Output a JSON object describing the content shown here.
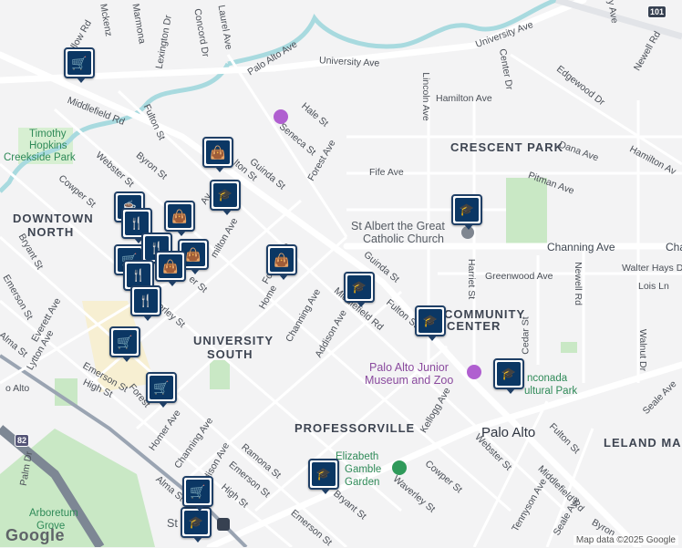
{
  "neighborhoods": [
    "DOWNTOWN",
    "NORTH",
    "UNIVERSITY",
    "SOUTH",
    "CRESCENT PARK",
    "PROFESSORVILLE",
    "COMMUNITY",
    "CENTER",
    "LELAND MAN"
  ],
  "city": "Palo Alto",
  "pois": {
    "park1": "Timothy",
    "park2": "Hopkins",
    "park3": "Creekside Park",
    "church1": "St Albert the Great",
    "church2": "Catholic Church",
    "museum1": "Palo Alto Junior",
    "museum2": "Museum and Zoo",
    "garden1": "Elizabeth",
    "garden2": "Gamble",
    "garden3": "Garden",
    "arboretum1": "Arboretum",
    "arboretum2": "Grove",
    "cultural1": "nconada",
    "cultural2": "ultural Park",
    "station": "St"
  },
  "streets": {
    "university_ave_top": "University Ave",
    "university_ave": "University Ave",
    "palo_alto_ave": "Palo Alto Ave",
    "hamilton_ave": "Hamilton Ave",
    "hamilton_ave_right": "Hamilton Av",
    "lincoln_ave": "Lincoln Ave",
    "center_dr": "Center Dr",
    "edgewood_dr": "Edgewood Dr",
    "newell_rd_top": "Newell Rd",
    "newell_rd": "Newell Rd",
    "dana_ave": "Dana Ave",
    "pitman_ave": "Pitman Ave",
    "fife_ave": "Fife Ave",
    "channing_ave": "Channing Ave",
    "channing_ave_edge": "Cha",
    "greenwood_ave": "Greenwood Ave",
    "walter_hays": "Walter Hays D",
    "lois_ln": "Lois Ln",
    "harriet_st": "Harriet St",
    "cedar_st": "Cedar St",
    "walnut_dr": "Walnut Dr",
    "seale_ave_right": "Seale Ave",
    "middlefield_rd_left": "Middlefield Rd",
    "middlefield_rd_mid": "Middlefield Rd",
    "middlefield_rd_bottom": "Middlefield Rd",
    "fulton_st_top": "Fulton St",
    "fulton_st_mid": "Fulton St",
    "fulton_st_bottom": "Fulton St",
    "byron_st": "Byron St",
    "byron_bottom": "Byron",
    "webster_st": "Webster St",
    "webster_st_bottom": "Webster St",
    "cowper_st": "Cowper St",
    "cowper_st_bottom": "Cowper St",
    "bryant_st": "Bryant St",
    "bryant_st_bottom": "Bryant St",
    "emerson_st_left": "Emerson St",
    "emerson_st": "Emerson St",
    "emerson_st_mid": "Emerson St",
    "emerson_st_bottom": "Emerson St",
    "everett_ave": "Everett Ave",
    "lytton_ave": "Lytton Ave",
    "high_st": "High St",
    "high_st_bottom": "High St",
    "alma_st_left": "Alma St",
    "alma_st_bottom": "Alma St",
    "forest_ave_top": "Forest Ave",
    "forest_ave_mid": "Forest Ave",
    "forest_bottom": "Forest",
    "homer_ave": "Homer Ave",
    "homer_mid": "Home",
    "channing_left": "Channing Ave",
    "channing_mid": "Channing Ave",
    "addison_ave": "Addison Ave",
    "addison_bottom": "dison Ave",
    "guinda_st_top": "Guinda St",
    "guinda_st_mid": "Guinda St",
    "kellogg_ave": "Kellogg Ave",
    "waverley_st": "Waverley St",
    "waverley_left": "erley St",
    "ramona_st": "Ramona St",
    "hale_st": "Hale St",
    "seneca_st": "Seneca St",
    "laurel_ave": "Laurel Ave",
    "concord_dr": "Concord Dr",
    "lexington_dr": "Lexington Dr",
    "marmona": "Marmona",
    "mckenzie": "Mckenz",
    "willow_rd": "llow Rd",
    "tennyson_ave": "Tennyson Ave",
    "seale_ave": "Seale Ave",
    "palm_dr": "Palm Dr",
    "hamilton_left": "milton Ave",
    "ave_frag": "Av",
    "er_st": "er St",
    "lton_st": "lton St",
    "hley_ave": "hley Ave",
    "alto_frag": "o Alto"
  },
  "shields": {
    "us101": "101",
    "ca82": "82"
  },
  "attribution": "Map data ©2025 Google",
  "logo": "Google",
  "colors": {
    "background": "#f3f3f4",
    "park": "#c9e8c5",
    "water": "#a8dadf",
    "highway": "#ffffff",
    "rail": "#9aa4b2",
    "pin": "#0b3764",
    "campus": "#f7efd2"
  },
  "markers": [
    {
      "type": "grocery"
    },
    {
      "type": "shopping"
    },
    {
      "type": "school"
    },
    {
      "type": "school"
    },
    {
      "type": "school"
    },
    {
      "type": "school"
    },
    {
      "type": "school"
    },
    {
      "type": "school"
    },
    {
      "type": "school"
    },
    {
      "type": "restaurant"
    },
    {
      "type": "restaurant"
    },
    {
      "type": "shopping"
    },
    {
      "type": "grocery"
    },
    {
      "type": "grocery"
    },
    {
      "type": "grocery"
    },
    {
      "type": "coffee"
    }
  ]
}
